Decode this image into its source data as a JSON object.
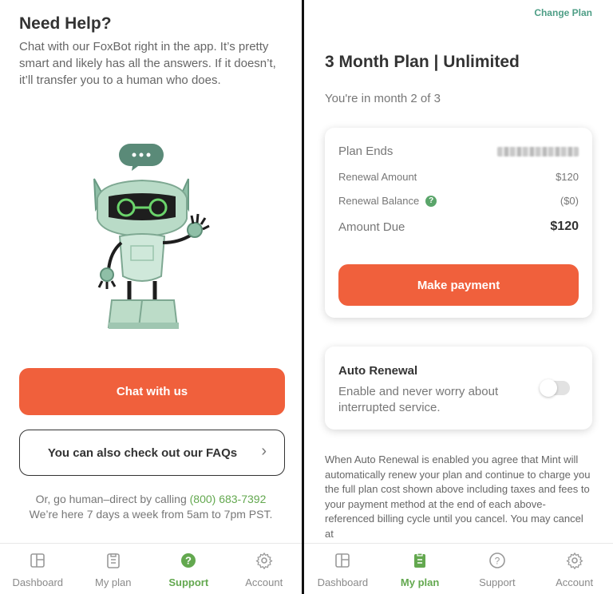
{
  "left": {
    "title": "Need Help?",
    "description": "Chat with our FoxBot right in the app. It’s pretty smart and likely has all the answers. If it doesn’t, it’ll transfer you to a human who does.",
    "chat_button": "Chat with us",
    "faq_button": "You can also check out our FAQs",
    "call_prefix": "Or, go human–direct by calling",
    "phone": "(800) 683-7392",
    "hours": "We’re here 7 days a week from 5am to 7pm PST.",
    "tabs": [
      {
        "label": "Dashboard",
        "icon": "dashboard-icon",
        "active": false
      },
      {
        "label": "My plan",
        "icon": "clipboard-icon",
        "active": false
      },
      {
        "label": "Support",
        "icon": "question-circle-icon",
        "active": true
      },
      {
        "label": "Account",
        "icon": "gear-icon",
        "active": false
      }
    ]
  },
  "right": {
    "change_plan": "Change Plan",
    "plan_title": "3 Month Plan | Unlimited",
    "plan_progress": "You're in month 2 of 3",
    "plan_card": {
      "plan_ends_label": "Plan Ends",
      "renewal_amount_label": "Renewal Amount",
      "renewal_amount_value": "$120",
      "renewal_balance_label": "Renewal Balance",
      "renewal_balance_value": "($0)",
      "amount_due_label": "Amount Due",
      "amount_due_value": "$120",
      "pay_button": "Make payment"
    },
    "auto_renewal": {
      "title": "Auto Renewal",
      "description": "Enable and never worry about interrupted service.",
      "enabled": false
    },
    "disclaimer": "When Auto Renewal is enabled you agree that Mint will automatically renew your plan and continue to charge you the full plan cost shown above including taxes and fees to your payment method at the end of each above-referenced billing cycle until you cancel. You may cancel at",
    "tabs": [
      {
        "label": "Dashboard",
        "icon": "dashboard-icon",
        "active": false
      },
      {
        "label": "My plan",
        "icon": "clipboard-icon",
        "active": true
      },
      {
        "label": "Support",
        "icon": "question-circle-icon",
        "active": false
      },
      {
        "label": "Account",
        "icon": "gear-icon",
        "active": false
      }
    ]
  },
  "colors": {
    "accent_orange": "#f0603c",
    "accent_green": "#63a84f",
    "link_teal": "#4e9e86",
    "text_dark": "#333333",
    "text_muted": "#777777"
  }
}
